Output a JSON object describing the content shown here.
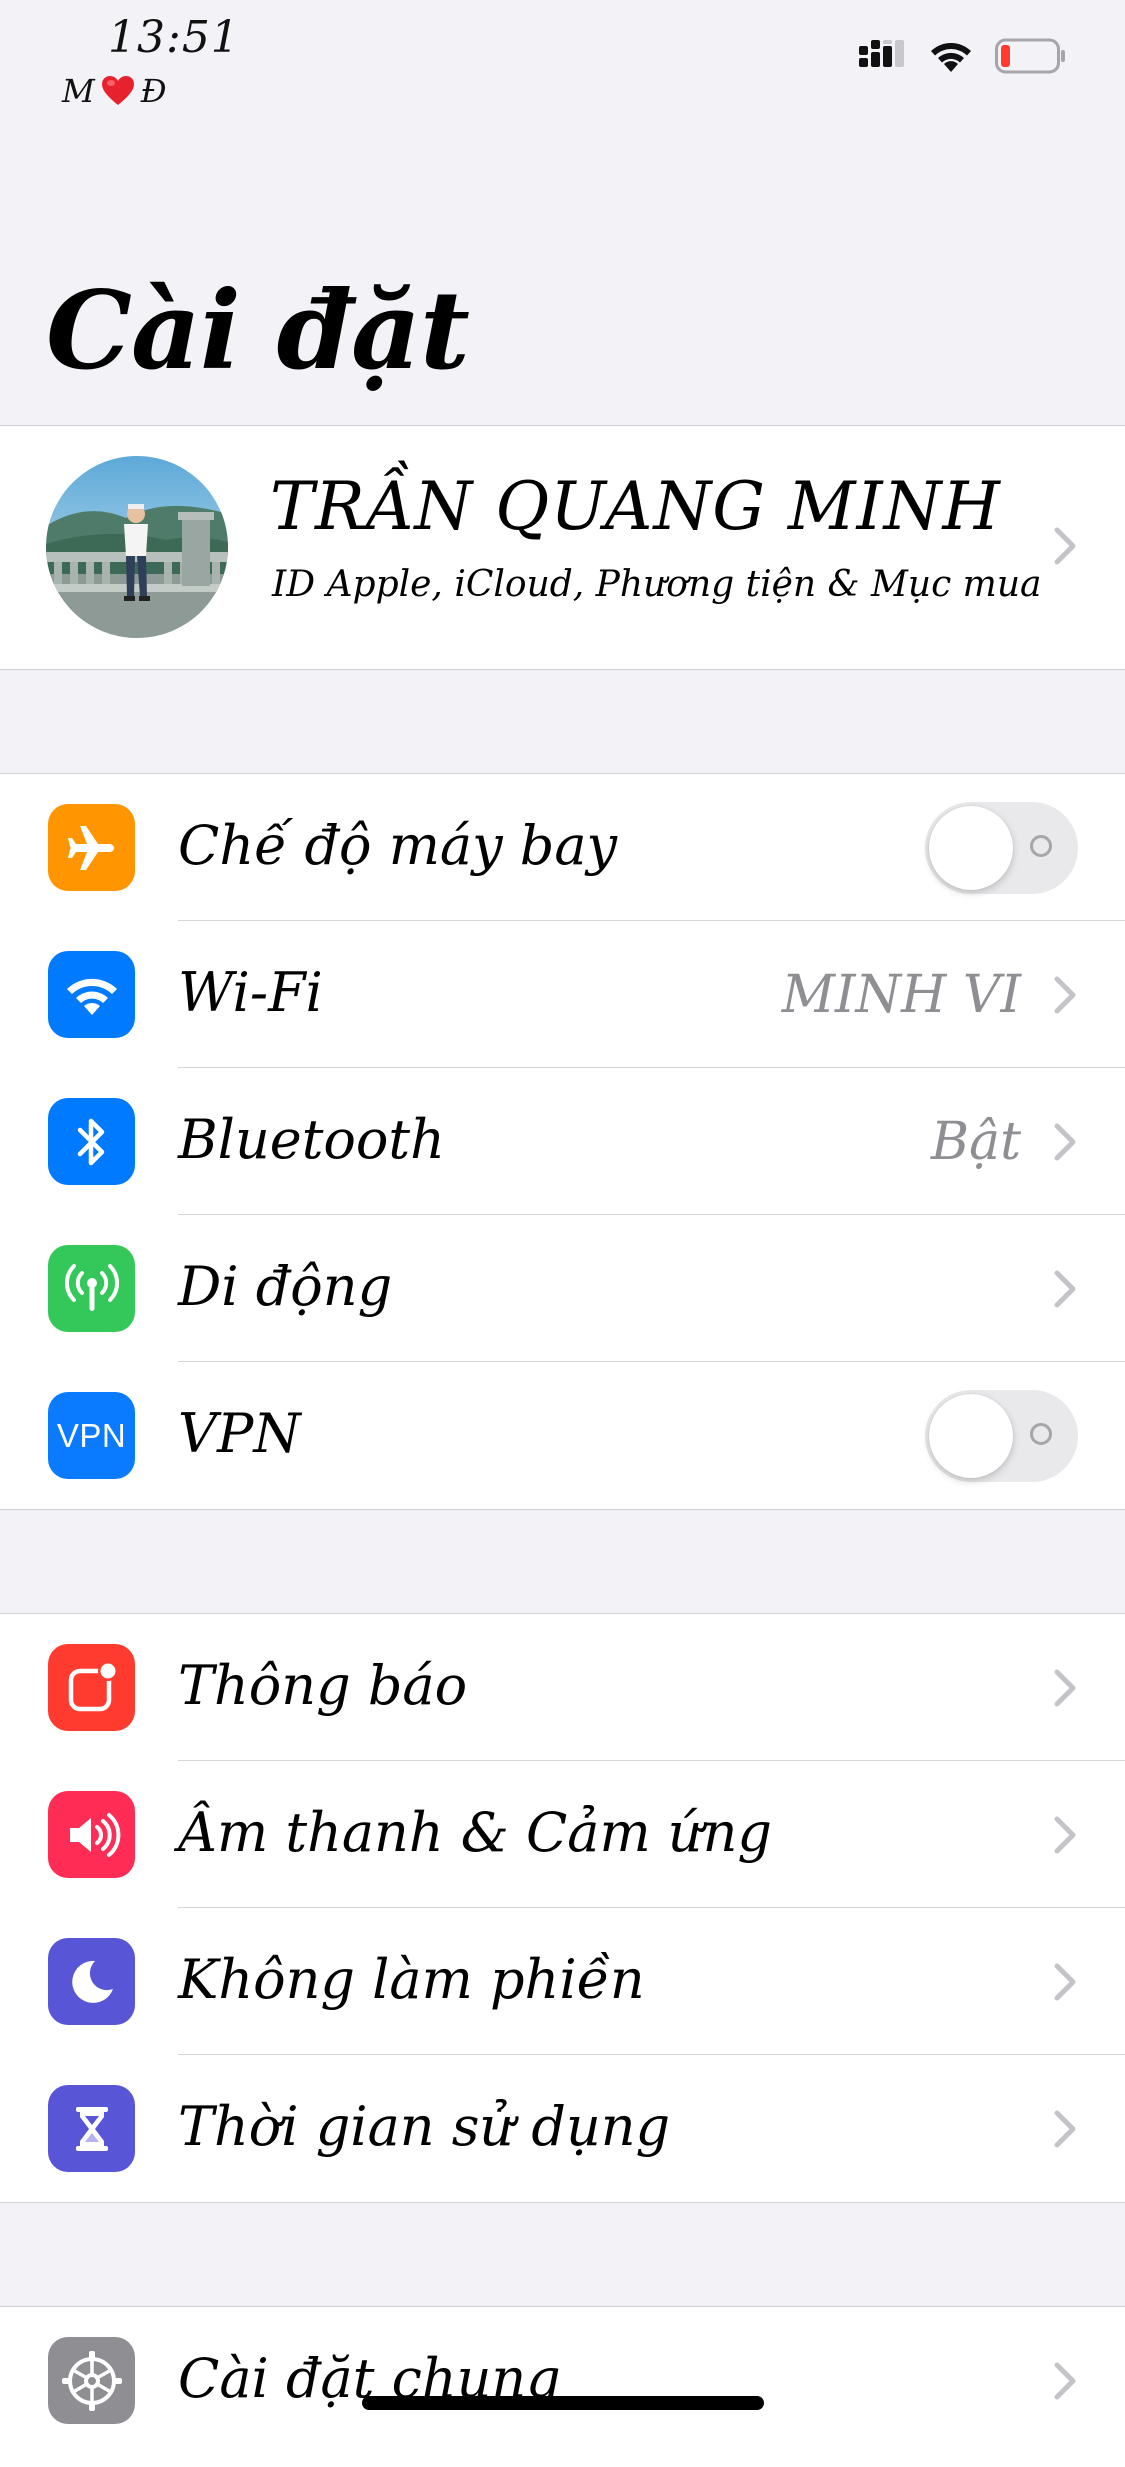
{
  "status_bar": {
    "time": "13:51",
    "carrier_left": "M",
    "carrier_right": "Đ",
    "battery_color": "#ff3b30"
  },
  "title": "Cài đặt",
  "profile": {
    "name": "TRẦN QUANG MINH",
    "subtitle": "ID Apple, iCloud, Phương tiện & Mục mua"
  },
  "groups": [
    {
      "rows": [
        {
          "label": "Chế độ máy bay",
          "icon": "airplane-icon",
          "icon_color": "#ff9500",
          "toggle": false
        },
        {
          "label": "Wi-Fi",
          "icon": "wifi-icon",
          "icon_color": "#007aff",
          "value": "MINH VI"
        },
        {
          "label": "Bluetooth",
          "icon": "bluetooth-icon",
          "icon_color": "#007aff",
          "value": "Bật"
        },
        {
          "label": "Di động",
          "icon": "cellular-antenna-icon",
          "icon_color": "#34c759"
        },
        {
          "label": "VPN",
          "icon": "vpn-icon",
          "icon_color": "#0a7aff",
          "icon_text": "VPN",
          "toggle": false
        }
      ]
    },
    {
      "rows": [
        {
          "label": "Thông báo",
          "icon": "notifications-icon",
          "icon_color": "#ff3b30"
        },
        {
          "label": "Âm thanh & Cảm ứng",
          "icon": "speaker-icon",
          "icon_color": "#ff2d55"
        },
        {
          "label": "Không làm phiền",
          "icon": "moon-icon",
          "icon_color": "#5856d6"
        },
        {
          "label": "Thời gian sử dụng",
          "icon": "hourglass-icon",
          "icon_color": "#5856d6"
        }
      ]
    },
    {
      "rows": [
        {
          "label": "Cài đặt chung",
          "icon": "gear-icon",
          "icon_color": "#8e8e93"
        }
      ]
    }
  ]
}
